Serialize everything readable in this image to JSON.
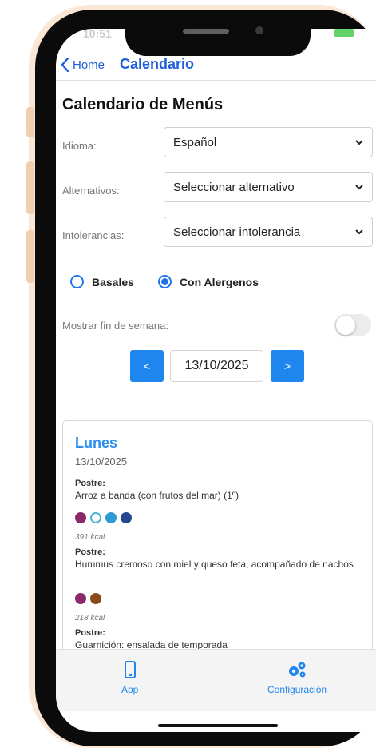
{
  "status": {
    "time": "10:51"
  },
  "nav": {
    "back_label": "Home",
    "title": "Calendario"
  },
  "page": {
    "title": "Calendario de Menús"
  },
  "filters": {
    "idioma": {
      "label": "Idioma:",
      "value": "Español"
    },
    "alternativos": {
      "label": "Alternativos:",
      "value": "Seleccionar alternativo"
    },
    "intolerancias": {
      "label": "Intolerancias:",
      "value": "Seleccionar intolerancia"
    }
  },
  "menu_type": {
    "options": [
      {
        "label": "Basales",
        "selected": false
      },
      {
        "label": "Con Alergenos",
        "selected": true
      }
    ]
  },
  "weekend": {
    "label": "Mostrar fin de semana:",
    "enabled": false
  },
  "date_nav": {
    "prev_label": "<",
    "date": "13/10/2025",
    "next_label": ">"
  },
  "day": {
    "name": "Lunes",
    "date": "13/10/2025",
    "meals": [
      {
        "course": "Postre:",
        "dish": "Arroz a banda (con frutos del mar) (1º)",
        "kcal": "391 kcal",
        "allergen_icons": [
          "gluten-icon",
          "crustacean-icon",
          "mollusc-icon",
          "fish-icon"
        ],
        "allergen_colors": [
          "#8a2a6a",
          "#4ab3d6",
          "#2f9bd6",
          "#24478f"
        ]
      },
      {
        "course": "Postre:",
        "dish": "Hummus cremoso con miel y queso feta, acompañado de nachos",
        "kcal": "218 kcal",
        "allergen_icons": [
          "gluten-icon",
          "sesame-icon"
        ],
        "allergen_colors": [
          "#8a2a6a",
          "#8a4a1a"
        ]
      },
      {
        "course": "Postre:",
        "dish": "Guarnición: ensalada de temporada"
      }
    ]
  },
  "tabs": [
    {
      "label": "App",
      "icon": "phone-icon"
    },
    {
      "label": "Configuración",
      "icon": "gears-icon"
    }
  ],
  "colors": {
    "accent": "#1f86f0",
    "title_blue": "#2a8fef",
    "nav_blue": "#1f5fd9"
  }
}
